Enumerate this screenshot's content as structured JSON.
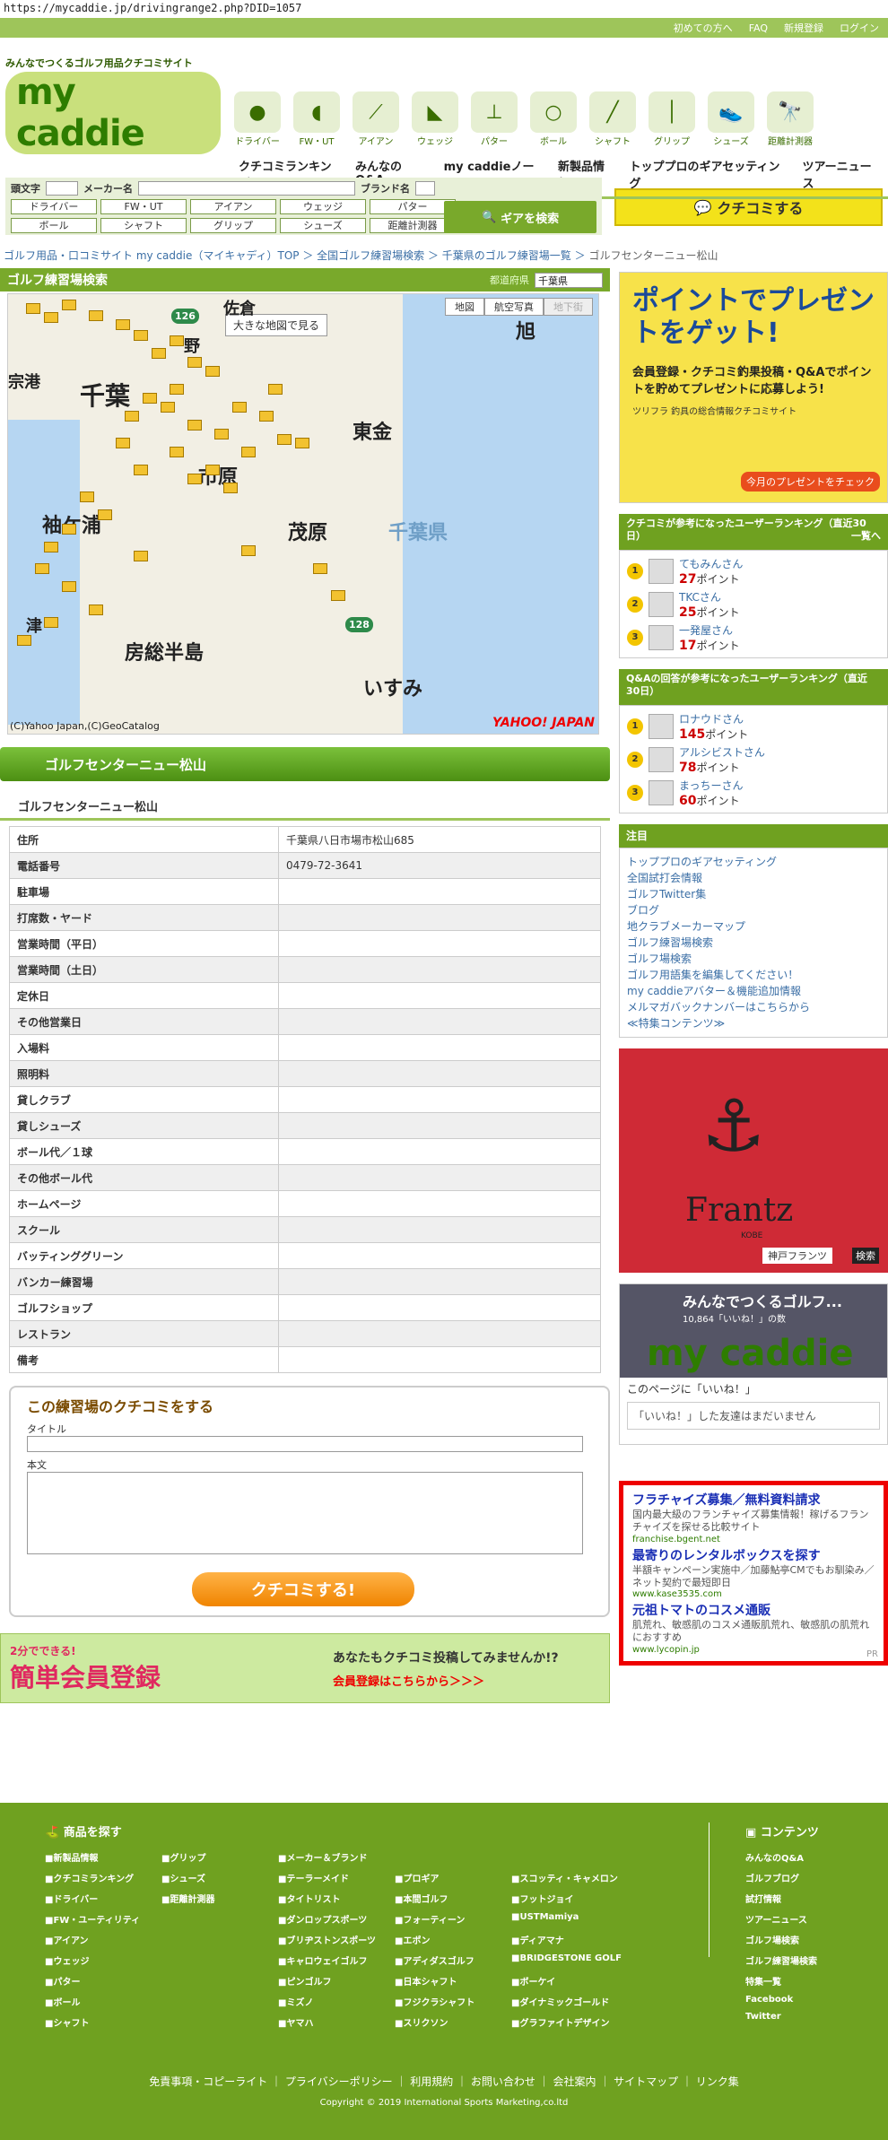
{
  "url": "https://mycaddie.jp/drivingrange2.php?DID=1057",
  "topnav": [
    "初めての方へ",
    "FAQ",
    "新規登録",
    "ログイン"
  ],
  "logo": {
    "tagline": "みんなでつくるゴルフ用品クチコミサイト",
    "name": "my caddie"
  },
  "categories": [
    {
      "icon": "driver-icon",
      "label": "ドライバー"
    },
    {
      "icon": "fw-ut-icon",
      "label": "FW・UT"
    },
    {
      "icon": "iron-icon",
      "label": "アイアン"
    },
    {
      "icon": "wedge-icon",
      "label": "ウェッジ"
    },
    {
      "icon": "putter-icon",
      "label": "パター"
    },
    {
      "icon": "ball-icon",
      "label": "ボール"
    },
    {
      "icon": "shaft-icon",
      "label": "シャフト"
    },
    {
      "icon": "grip-icon",
      "label": "グリップ"
    },
    {
      "icon": "shoes-icon",
      "label": "シューズ"
    },
    {
      "icon": "rangefinder-icon",
      "label": "距離計測器"
    }
  ],
  "mainnav": [
    "クチコミランキング",
    "みんなのQ&A",
    "my caddieノート",
    "新製品情報",
    "トッププロのギアセッティング",
    "ツアーニュース"
  ],
  "search": {
    "initial_label": "頭文字",
    "maker_label": "メーカー名",
    "brand_label": "ブランド名",
    "buttons": [
      "ドライバー",
      "FW・UT",
      "アイアン",
      "ウェッジ",
      "パター",
      "ボール",
      "シャフト",
      "グリップ",
      "シューズ",
      "距離計測器"
    ],
    "gear_button": "ギアを検索"
  },
  "kuchikomi_button": "クチコミする",
  "breadcrumb": [
    "ゴルフ用品・口コミサイト my caddie（マイキャディ）TOP",
    "全国ゴルフ練習場検索",
    "千葉県のゴルフ練習場一覧",
    "ゴルフセンターニュー松山"
  ],
  "range_search": {
    "title": "ゴルフ練習場検索",
    "pref_label": "都道府県",
    "pref_value": "千葉県",
    "map_buttons": [
      "地図",
      "航空写真",
      "地下街"
    ],
    "bigmap_button": "大きな地図で見る",
    "map_labels": [
      "佐倉",
      "旭",
      "千葉",
      "東金",
      "市原",
      "茂原",
      "千葉県",
      "袖ケ浦",
      "房総半島",
      "いすみ",
      "津",
      "宗港",
      "野"
    ],
    "road_numbers": [
      "126",
      "128"
    ],
    "copyright": "(C)Yahoo Japan,(C)GeoCatalog",
    "yahoo": "YAHOO! JAPAN"
  },
  "facility": {
    "title": "ゴルフセンターニュー松山",
    "subtitle": "ゴルフセンターニュー松山",
    "rows": [
      {
        "k": "住所",
        "v": "千葉県八日市場市松山685"
      },
      {
        "k": "電話番号",
        "v": "0479-72-3641"
      },
      {
        "k": "駐車場",
        "v": ""
      },
      {
        "k": "打席数・ヤード",
        "v": ""
      },
      {
        "k": "営業時間（平日）",
        "v": ""
      },
      {
        "k": "営業時間（土日）",
        "v": ""
      },
      {
        "k": "定休日",
        "v": ""
      },
      {
        "k": "その他営業日",
        "v": ""
      },
      {
        "k": "入場料",
        "v": ""
      },
      {
        "k": "照明料",
        "v": ""
      },
      {
        "k": "貸しクラブ",
        "v": ""
      },
      {
        "k": "貸しシューズ",
        "v": ""
      },
      {
        "k": "ボール代／１球",
        "v": ""
      },
      {
        "k": "その他ボール代",
        "v": ""
      },
      {
        "k": "ホームページ",
        "v": ""
      },
      {
        "k": "スクール",
        "v": ""
      },
      {
        "k": "バッティンググリーン",
        "v": ""
      },
      {
        "k": "バンカー練習場",
        "v": ""
      },
      {
        "k": "ゴルフショップ",
        "v": ""
      },
      {
        "k": "レストラン",
        "v": ""
      },
      {
        "k": "備考",
        "v": ""
      }
    ]
  },
  "review_form": {
    "title": "この練習場のクチコミをする",
    "title_label": "タイトル",
    "body_label": "本文",
    "submit": "クチコミする!"
  },
  "register": {
    "badge": "2分でできる!",
    "big": "簡単会員登録",
    "text": "あなたもクチコミ投稿してみませんか!?",
    "link": "会員登録はこちらから＞＞＞"
  },
  "ad_point": {
    "headline": "ポイントでプレゼントをゲット!",
    "body": "会員登録・クチコミ釣果投稿・Q&Aでポイントを貯めてプレゼントに応募しよう!",
    "brand": "ツリフラ 釣具の総合情報クチコミサイト",
    "button": "今月のプレゼントをチェック"
  },
  "ranking_kuchikomi": {
    "title": "クチコミが参考になったユーザーランキング（直近30日）",
    "more": "一覧へ",
    "items": [
      {
        "rank": "1",
        "name": "てもみんさん",
        "pt": "27",
        "unit": "ポイント"
      },
      {
        "rank": "2",
        "name": "TKCさん",
        "pt": "25",
        "unit": "ポイント"
      },
      {
        "rank": "3",
        "name": "一発屋さん",
        "pt": "17",
        "unit": "ポイント"
      }
    ]
  },
  "ranking_qa": {
    "title": "Q&Aの回答が参考になったユーザーランキング（直近30日）",
    "items": [
      {
        "rank": "1",
        "name": "ロナウドさん",
        "pt": "145",
        "unit": "ポイント"
      },
      {
        "rank": "2",
        "name": "アルシビストさん",
        "pt": "78",
        "unit": "ポイント"
      },
      {
        "rank": "3",
        "name": "まっちーさん",
        "pt": "60",
        "unit": "ポイント"
      }
    ]
  },
  "notice": {
    "title": "注目",
    "items": [
      "トッププロのギアセッティング",
      "全国試打会情報",
      "ゴルフTwitter集",
      "ブログ",
      "地クラブメーカーマップ",
      "ゴルフ練習場検索",
      "ゴルフ場検索",
      "ゴルフ用語集を編集してください！",
      "my caddieアバター＆機能追加情報",
      "メルマガバックナンバーはこちらから",
      "≪特集コンテンツ≫"
    ]
  },
  "frantz": {
    "name": "Frantz",
    "sub": "KOBE",
    "search": "神戸フランツ",
    "button": "検索"
  },
  "fb": {
    "name": "みんなでつくるゴルフ...",
    "likes": "10,864「いいね！」の数",
    "logo": "my caddie",
    "like_button": "このページに「いいね！」",
    "friends": "「いいね！」した友達はまだいません"
  },
  "pr_ad": {
    "items": [
      {
        "a": "フラチャイズ募集／無料資料請求",
        "d": "国内最大級のフランチャイズ募集情報！稼げるフランチャイズを探せる比較サイト",
        "u": "franchise.bgent.net"
      },
      {
        "a": "最寄りのレンタルボックスを探す",
        "d": "半額キャンペーン実施中／加藤鮎亭CMでもお馴染み／ネット契約で最短即日",
        "u": "www.kase3535.com"
      },
      {
        "a": "元祖トマトのコスメ通販",
        "d": "肌荒れ、敏感肌のコスメ通販肌荒れ、敏感肌の肌荒れにおすすめ",
        "u": "www.lycopin.jp"
      }
    ],
    "pr": "PR"
  },
  "footer": {
    "products_title": "商品を探す",
    "products": [
      "新製品情報",
      "グリップ",
      "メーカー＆ブランド",
      "",
      "",
      "クチコミランキング",
      "シューズ",
      "テーラーメイド",
      "プロギア",
      "スコッティ・キャメロン",
      "ドライバー",
      "距離計測器",
      "タイトリスト",
      "本間ゴルフ",
      "フットジョイ",
      "FW・ユーティリティ",
      "",
      "ダンロップスポーツ",
      "フォーティーン",
      "USTMamiya",
      "アイアン",
      "",
      "ブリヂストンスポーツ",
      "エポン",
      "ディアマナ",
      "ウェッジ",
      "",
      "キャロウェイゴルフ",
      "アディダスゴルフ",
      "BRIDGESTONE GOLF",
      "パター",
      "",
      "ピンゴルフ",
      "日本シャフト",
      "ボーケイ",
      "ボール",
      "",
      "ミズノ",
      "フジクラシャフト",
      "ダイナミックゴールド",
      "シャフト",
      "",
      "ヤマハ",
      "スリクソン",
      "グラファイトデザイン"
    ],
    "contents_title": "コンテンツ",
    "contents": [
      "みんなのQ&A",
      "ゴルフブログ",
      "試打情報",
      "ツアーニュース",
      "ゴルフ場検索",
      "ゴルフ練習場検索",
      "特集一覧",
      "Facebook",
      "Twitter"
    ],
    "links": "免責事項・コピーライト ｜ プライバシーポリシー ｜ 利用規約 ｜ お問い合わせ ｜ 会社案内 ｜ サイトマップ ｜ リンク集",
    "copyright": "Copyright © 2019 International Sports Marketing,co.ltd"
  }
}
